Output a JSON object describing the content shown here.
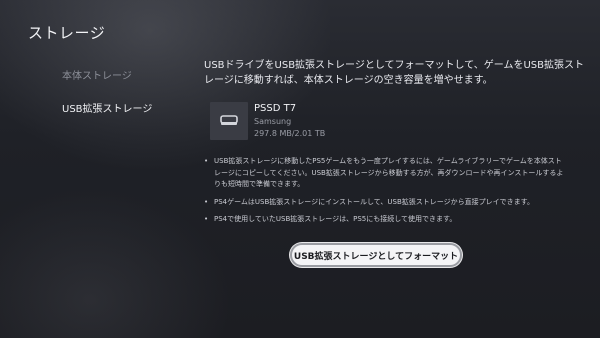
{
  "header": {
    "title": "ストレージ"
  },
  "sidebar": {
    "items": [
      {
        "label": "本体ストレージ"
      },
      {
        "label": "USB拡張ストレージ"
      }
    ]
  },
  "main": {
    "description": "USBドライブをUSB拡張ストレージとしてフォーマットして、ゲームをUSB拡張ストレージに移動すれば、本体ストレージの空き容量を増やせます。",
    "drive": {
      "icon": "usb-drive-icon",
      "name": "PSSD T7",
      "manufacturer": "Samsung",
      "capacity": "297.8 MB/2.01 TB"
    },
    "notes": [
      "USB拡張ストレージに移動したPS5ゲームをもう一度プレイするには、ゲームライブラリーでゲームを本体ストレージにコピーしてください。USB拡張ストレージから移動する方が、再ダウンロードや再インストールするよりも短時間で準備できます。",
      "PS4ゲームはUSB拡張ストレージにインストールして、USB拡張ストレージから直接プレイできます。",
      "PS4で使用していたUSB拡張ストレージは、PS5にも接続して使用できます。"
    ],
    "format_button": "USB拡張ストレージとしてフォーマット"
  }
}
